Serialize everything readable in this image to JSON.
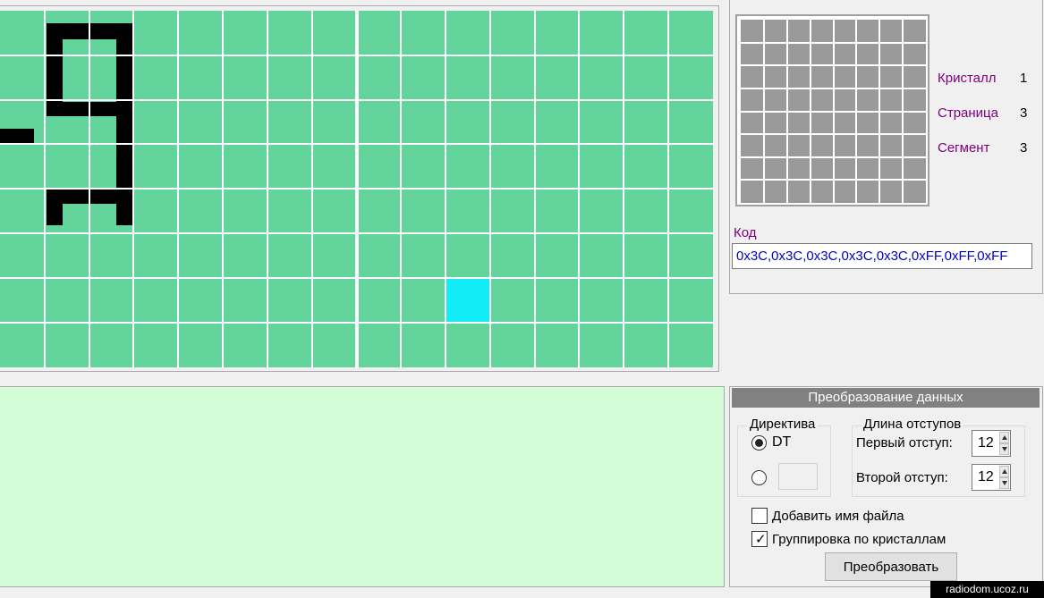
{
  "grid": {
    "columns": 16,
    "rows": 8,
    "cell_color": "#63d49b",
    "line_color": "#ffffff",
    "ink_color": "#000000",
    "cursor_color": "#12ecf6",
    "cursor_cell": {
      "col": 10,
      "row": 6
    }
  },
  "preview": {
    "columns": 8,
    "rows": 8,
    "fill_color": "#9a9a9a"
  },
  "info": {
    "crystal_label": "Кристалл",
    "crystal_value": "1",
    "page_label": "Страница",
    "page_value": "3",
    "segment_label": "Сегмент",
    "segment_value": "3"
  },
  "code": {
    "label": "Код",
    "value": "0x3C,0x3C,0x3C,0x3C,0x3C,0xFF,0xFF,0xFF"
  },
  "conversion": {
    "title": "Преобразование данных",
    "directive_group": "Директива",
    "directive_dt": "DT",
    "indent_group": "Длина отступов",
    "first_indent_label": "Первый отступ:",
    "first_indent_value": "12",
    "second_indent_label": "Второй отступ:",
    "second_indent_value": "12",
    "add_filename_label": "Добавить имя файла",
    "add_filename_checked": false,
    "group_by_crystal_label": "Группировка по кристаллам",
    "group_by_crystal_checked": true,
    "convert_button": "Преобразовать"
  },
  "watermark": "radiodom.ucoz.ru"
}
